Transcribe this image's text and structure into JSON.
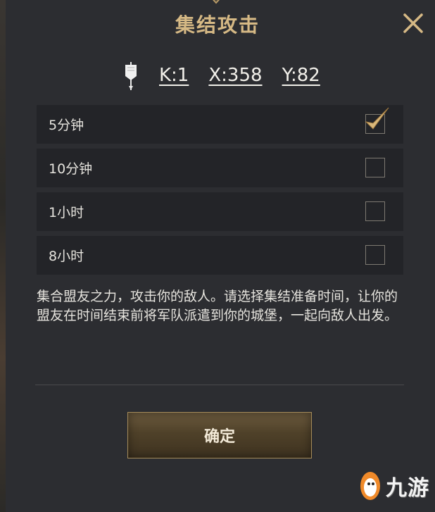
{
  "colors": {
    "panel_bg": "#2c2d31",
    "row_bg": "#232428",
    "title_gold": "#d6b985",
    "button_gold": "#a68c5a"
  },
  "header": {
    "title": "集结攻击",
    "close_icon": "close-icon"
  },
  "coordinates": {
    "flag_icon": "banner-flag-icon",
    "k": "K:1",
    "x": "X:358",
    "y": "Y:82"
  },
  "options": [
    {
      "label": "5分钟",
      "checked": true
    },
    {
      "label": "10分钟",
      "checked": false
    },
    {
      "label": "1小时",
      "checked": false
    },
    {
      "label": "8小时",
      "checked": false
    }
  ],
  "description": "集合盟友之力，攻击你的敌人。请选择集结准备时间，让你的盟友在时间结束前将军队派遣到你的城堡，一起向敌人出发。",
  "confirm_button": "确定",
  "watermark": {
    "text": "九游",
    "icon": "mascot-logo-icon"
  }
}
